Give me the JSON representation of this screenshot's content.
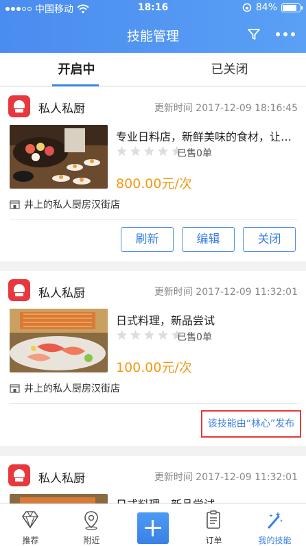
{
  "statusbar": {
    "carrier": "中国移动",
    "time": "18:16",
    "battery_pct": "84%"
  },
  "header": {
    "title": "技能管理",
    "filter_icon": "filter-icon",
    "more_icon": "more-icon"
  },
  "tabs": [
    {
      "label": "开启中",
      "active": true
    },
    {
      "label": "已关闭",
      "active": false
    }
  ],
  "cards": [
    {
      "shop_name": "私人私厨",
      "update_time": "更新时间 2017-12-09 18:16:45",
      "description": "专业日料店，新鲜美味的食材，让您吃得放心",
      "rating": 0,
      "sold": "已售0单",
      "price": "800.00元/次",
      "store": "井上的私人厨房汉街店",
      "actions": {
        "refresh": "刷新",
        "edit": "编辑",
        "close": "关闭"
      }
    },
    {
      "shop_name": "私人私厨",
      "update_time": "更新时间 2017-12-09 11:32:01",
      "description": "日式料理，新品尝试",
      "rating": 0,
      "sold": "已售0单",
      "price": "100.00元/次",
      "store": "井上的私人厨房汉街店",
      "publisher_note": "该技能由“林心”发布"
    },
    {
      "shop_name": "私人私厨",
      "update_time": "更新时间 2017-12-09 11:32:01",
      "description": "日式料理，新品尝试"
    }
  ],
  "bottom_nav": [
    {
      "label": "推荐",
      "icon": "diamond-icon"
    },
    {
      "label": "附近",
      "icon": "location-pin-icon"
    },
    {
      "label": "",
      "icon": "plus-icon"
    },
    {
      "label": "订单",
      "icon": "clipboard-icon"
    },
    {
      "label": "我的技能",
      "icon": "magic-wand-icon",
      "active": true
    }
  ],
  "colors": {
    "primary": "#4a8cf0",
    "price": "#f09a14",
    "logo": "#e8383d",
    "highlight_border": "#e53935"
  }
}
